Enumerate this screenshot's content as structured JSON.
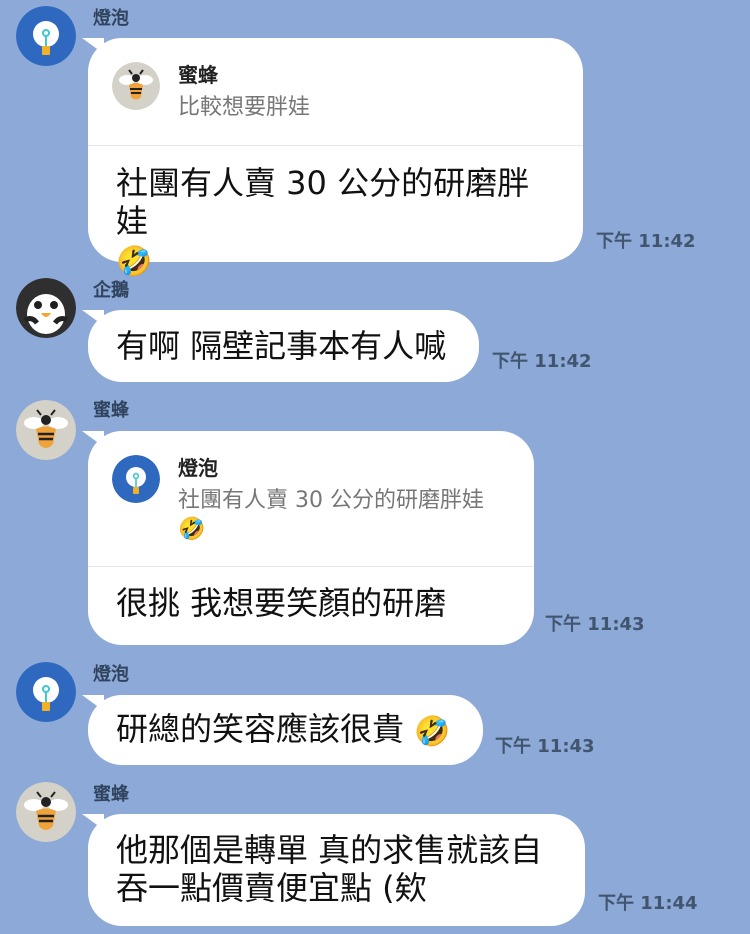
{
  "messages": [
    {
      "sender": "燈泡",
      "avatar_icon": "lightbulb-icon",
      "reply": {
        "sender": "蜜蜂",
        "avatar_icon": "bee-icon",
        "text": "比較想要胖娃"
      },
      "text_line_1": "社團有人賣 30 公分的研磨胖娃",
      "text_line_2": "🤣",
      "time": "下午 11:42"
    },
    {
      "sender": "企鵝",
      "avatar_icon": "penguin-icon",
      "text": "有啊 隔壁記事本有人喊",
      "time": "下午 11:42"
    },
    {
      "sender": "蜜蜂",
      "avatar_icon": "bee-icon",
      "reply": {
        "sender": "燈泡",
        "avatar_icon": "lightbulb-icon",
        "text_line_1": "社團有人賣 30 公分的研磨胖娃",
        "text_line_2": "🤣"
      },
      "text": "很挑  我想要笑顏的研磨",
      "time": "下午 11:43"
    },
    {
      "sender": "燈泡",
      "avatar_icon": "lightbulb-icon",
      "text": "研總的笑容應該很貴",
      "emoji": "🤣",
      "time": "下午 11:43"
    },
    {
      "sender": "蜜蜂",
      "avatar_icon": "bee-icon",
      "text_line_1": "他那個是轉單  真的求售就該自",
      "text_line_2": "吞一點價賣便宜點 (欸",
      "time": "下午 11:44"
    }
  ],
  "colors": {
    "background": "#8ca9d7",
    "bubble": "#ffffff",
    "sender": "#31445f",
    "timestamp": "#42556f",
    "lightbulb_avatar": "#2f69bf",
    "bee_avatar": "#d4d2c8",
    "penguin_avatar": "#2f2f2f"
  }
}
